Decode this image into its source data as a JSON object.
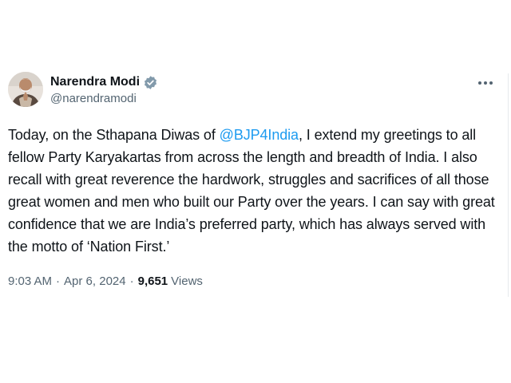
{
  "author": {
    "display_name": "Narendra Modi",
    "handle": "@narendramodi",
    "verified": true
  },
  "tweet": {
    "text_part1": "Today, on the Sthapana Diwas of ",
    "mention": "@BJP4India",
    "text_part2": ", I extend my greetings to all fellow Party Karyakartas from across the length and breadth of India. I also recall with great reverence the hardwork, struggles and sacrifices of all those great women and men who built our Party over the years. I can say with great confidence that we are India’s preferred party, which has always served with the motto of ‘Nation First.’"
  },
  "meta": {
    "time": "9:03 AM",
    "separator": "·",
    "date": "Apr 6, 2024",
    "views_count": "9,651",
    "views_label": "Views"
  },
  "colors": {
    "text": "#0f1419",
    "secondary": "#536471",
    "link": "#1d9bf0",
    "verified_badge": "#829aab"
  },
  "icons": {
    "verified": "verified-badge-icon",
    "more": "more-options-icon"
  }
}
